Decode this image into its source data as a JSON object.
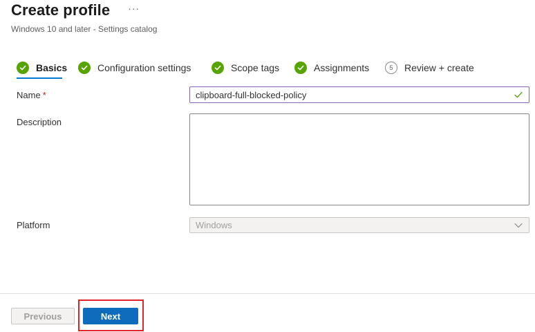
{
  "header": {
    "title": "Create profile",
    "more_icon": "more-horizontal-icon",
    "more_glyph": "···",
    "subtitle": "Windows 10 and later - Settings catalog"
  },
  "steps": [
    {
      "label": "Basics",
      "status": "done",
      "active": true,
      "icon": "check-circle-icon"
    },
    {
      "label": "Configuration settings",
      "status": "done",
      "active": false,
      "icon": "check-circle-icon"
    },
    {
      "label": "Scope tags",
      "status": "done",
      "active": false,
      "icon": "check-circle-icon"
    },
    {
      "label": "Assignments",
      "status": "done",
      "active": false,
      "icon": "check-circle-icon"
    },
    {
      "label": "Review + create",
      "status": "pending",
      "active": false,
      "number": "5"
    }
  ],
  "form": {
    "name": {
      "label": "Name",
      "required_mark": "*",
      "value": "clipboard-full-blocked-policy",
      "valid_icon": "check-icon"
    },
    "description": {
      "label": "Description",
      "value": ""
    },
    "platform": {
      "label": "Platform",
      "value": "Windows",
      "disabled": true,
      "icon": "chevron-down-icon"
    }
  },
  "footer": {
    "previous_label": "Previous",
    "next_label": "Next"
  },
  "colors": {
    "accent": "#0f6cbd",
    "success": "#57a300",
    "highlight": "#e0242a",
    "focus_border": "#8764b8"
  }
}
